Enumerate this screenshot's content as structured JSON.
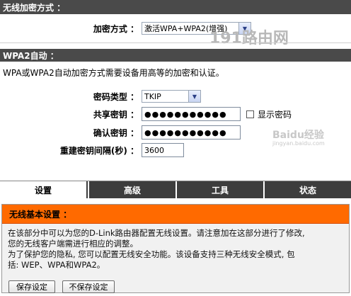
{
  "wireless_encryption": {
    "section_title": "无线加密方式 ：",
    "mode_label": "加密方式 ：",
    "mode_value": "激活WPA+WPA2(增强)"
  },
  "wpa2_auto": {
    "section_title": "WPA2自动 ：",
    "description": "WPA或WPA2自动加密方式需要设备用高等的加密和认证。",
    "cipher_label": "密码类型 ：",
    "cipher_value": "TKIP",
    "psk_label": "共享密钥 ：",
    "psk_value": "●●●●●●●●●●●",
    "show_password_label": "显示密码",
    "confirm_label": "确认密钥 ：",
    "confirm_value": "●●●●●●●●●●●",
    "rekey_label": "重建密钥间隔(秒) ：",
    "rekey_value": "3600"
  },
  "tabs": [
    {
      "label": "设置",
      "active": true
    },
    {
      "label": "高级",
      "active": false
    },
    {
      "label": "工具",
      "active": false
    },
    {
      "label": "状态",
      "active": false
    }
  ],
  "basic_panel": {
    "title": "无线基本设置 ：",
    "line1": "在该部分中可以为您的D-Link路由器配置无线设置。请注意加在这部分进行了修改,",
    "line2": "您的无线客户端需进行相应的调整。",
    "line3": "为了保护您的隐私, 您可以配置无线安全功能。该设备支持三种无线安全模式, 包",
    "line4": "括: WEP、WPA和WPA2。",
    "save_label": "保存设定",
    "dont_save_label": "不保存设定"
  },
  "watermarks": {
    "site": "191路由网",
    "baidu": "Baidu经验",
    "baidu_sub": "jingyan.baidu.com"
  }
}
